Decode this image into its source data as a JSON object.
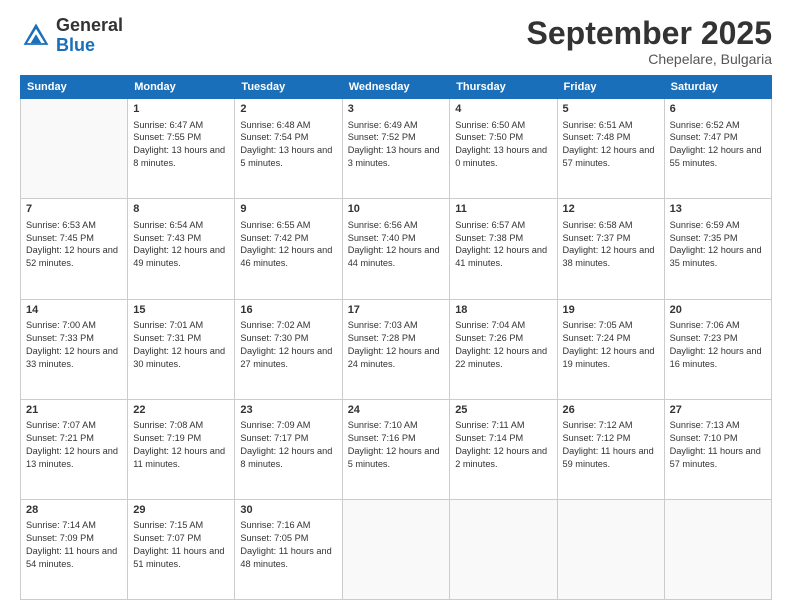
{
  "header": {
    "logo_general": "General",
    "logo_blue": "Blue",
    "month_title": "September 2025",
    "subtitle": "Chepelare, Bulgaria"
  },
  "days": [
    "Sunday",
    "Monday",
    "Tuesday",
    "Wednesday",
    "Thursday",
    "Friday",
    "Saturday"
  ],
  "weeks": [
    [
      {
        "day": "",
        "sunrise": "",
        "sunset": "",
        "daylight": ""
      },
      {
        "day": "1",
        "sunrise": "Sunrise: 6:47 AM",
        "sunset": "Sunset: 7:55 PM",
        "daylight": "Daylight: 13 hours and 8 minutes."
      },
      {
        "day": "2",
        "sunrise": "Sunrise: 6:48 AM",
        "sunset": "Sunset: 7:54 PM",
        "daylight": "Daylight: 13 hours and 5 minutes."
      },
      {
        "day": "3",
        "sunrise": "Sunrise: 6:49 AM",
        "sunset": "Sunset: 7:52 PM",
        "daylight": "Daylight: 13 hours and 3 minutes."
      },
      {
        "day": "4",
        "sunrise": "Sunrise: 6:50 AM",
        "sunset": "Sunset: 7:50 PM",
        "daylight": "Daylight: 13 hours and 0 minutes."
      },
      {
        "day": "5",
        "sunrise": "Sunrise: 6:51 AM",
        "sunset": "Sunset: 7:48 PM",
        "daylight": "Daylight: 12 hours and 57 minutes."
      },
      {
        "day": "6",
        "sunrise": "Sunrise: 6:52 AM",
        "sunset": "Sunset: 7:47 PM",
        "daylight": "Daylight: 12 hours and 55 minutes."
      }
    ],
    [
      {
        "day": "7",
        "sunrise": "Sunrise: 6:53 AM",
        "sunset": "Sunset: 7:45 PM",
        "daylight": "Daylight: 12 hours and 52 minutes."
      },
      {
        "day": "8",
        "sunrise": "Sunrise: 6:54 AM",
        "sunset": "Sunset: 7:43 PM",
        "daylight": "Daylight: 12 hours and 49 minutes."
      },
      {
        "day": "9",
        "sunrise": "Sunrise: 6:55 AM",
        "sunset": "Sunset: 7:42 PM",
        "daylight": "Daylight: 12 hours and 46 minutes."
      },
      {
        "day": "10",
        "sunrise": "Sunrise: 6:56 AM",
        "sunset": "Sunset: 7:40 PM",
        "daylight": "Daylight: 12 hours and 44 minutes."
      },
      {
        "day": "11",
        "sunrise": "Sunrise: 6:57 AM",
        "sunset": "Sunset: 7:38 PM",
        "daylight": "Daylight: 12 hours and 41 minutes."
      },
      {
        "day": "12",
        "sunrise": "Sunrise: 6:58 AM",
        "sunset": "Sunset: 7:37 PM",
        "daylight": "Daylight: 12 hours and 38 minutes."
      },
      {
        "day": "13",
        "sunrise": "Sunrise: 6:59 AM",
        "sunset": "Sunset: 7:35 PM",
        "daylight": "Daylight: 12 hours and 35 minutes."
      }
    ],
    [
      {
        "day": "14",
        "sunrise": "Sunrise: 7:00 AM",
        "sunset": "Sunset: 7:33 PM",
        "daylight": "Daylight: 12 hours and 33 minutes."
      },
      {
        "day": "15",
        "sunrise": "Sunrise: 7:01 AM",
        "sunset": "Sunset: 7:31 PM",
        "daylight": "Daylight: 12 hours and 30 minutes."
      },
      {
        "day": "16",
        "sunrise": "Sunrise: 7:02 AM",
        "sunset": "Sunset: 7:30 PM",
        "daylight": "Daylight: 12 hours and 27 minutes."
      },
      {
        "day": "17",
        "sunrise": "Sunrise: 7:03 AM",
        "sunset": "Sunset: 7:28 PM",
        "daylight": "Daylight: 12 hours and 24 minutes."
      },
      {
        "day": "18",
        "sunrise": "Sunrise: 7:04 AM",
        "sunset": "Sunset: 7:26 PM",
        "daylight": "Daylight: 12 hours and 22 minutes."
      },
      {
        "day": "19",
        "sunrise": "Sunrise: 7:05 AM",
        "sunset": "Sunset: 7:24 PM",
        "daylight": "Daylight: 12 hours and 19 minutes."
      },
      {
        "day": "20",
        "sunrise": "Sunrise: 7:06 AM",
        "sunset": "Sunset: 7:23 PM",
        "daylight": "Daylight: 12 hours and 16 minutes."
      }
    ],
    [
      {
        "day": "21",
        "sunrise": "Sunrise: 7:07 AM",
        "sunset": "Sunset: 7:21 PM",
        "daylight": "Daylight: 12 hours and 13 minutes."
      },
      {
        "day": "22",
        "sunrise": "Sunrise: 7:08 AM",
        "sunset": "Sunset: 7:19 PM",
        "daylight": "Daylight: 12 hours and 11 minutes."
      },
      {
        "day": "23",
        "sunrise": "Sunrise: 7:09 AM",
        "sunset": "Sunset: 7:17 PM",
        "daylight": "Daylight: 12 hours and 8 minutes."
      },
      {
        "day": "24",
        "sunrise": "Sunrise: 7:10 AM",
        "sunset": "Sunset: 7:16 PM",
        "daylight": "Daylight: 12 hours and 5 minutes."
      },
      {
        "day": "25",
        "sunrise": "Sunrise: 7:11 AM",
        "sunset": "Sunset: 7:14 PM",
        "daylight": "Daylight: 12 hours and 2 minutes."
      },
      {
        "day": "26",
        "sunrise": "Sunrise: 7:12 AM",
        "sunset": "Sunset: 7:12 PM",
        "daylight": "Daylight: 11 hours and 59 minutes."
      },
      {
        "day": "27",
        "sunrise": "Sunrise: 7:13 AM",
        "sunset": "Sunset: 7:10 PM",
        "daylight": "Daylight: 11 hours and 57 minutes."
      }
    ],
    [
      {
        "day": "28",
        "sunrise": "Sunrise: 7:14 AM",
        "sunset": "Sunset: 7:09 PM",
        "daylight": "Daylight: 11 hours and 54 minutes."
      },
      {
        "day": "29",
        "sunrise": "Sunrise: 7:15 AM",
        "sunset": "Sunset: 7:07 PM",
        "daylight": "Daylight: 11 hours and 51 minutes."
      },
      {
        "day": "30",
        "sunrise": "Sunrise: 7:16 AM",
        "sunset": "Sunset: 7:05 PM",
        "daylight": "Daylight: 11 hours and 48 minutes."
      },
      {
        "day": "",
        "sunrise": "",
        "sunset": "",
        "daylight": ""
      },
      {
        "day": "",
        "sunrise": "",
        "sunset": "",
        "daylight": ""
      },
      {
        "day": "",
        "sunrise": "",
        "sunset": "",
        "daylight": ""
      },
      {
        "day": "",
        "sunrise": "",
        "sunset": "",
        "daylight": ""
      }
    ]
  ]
}
